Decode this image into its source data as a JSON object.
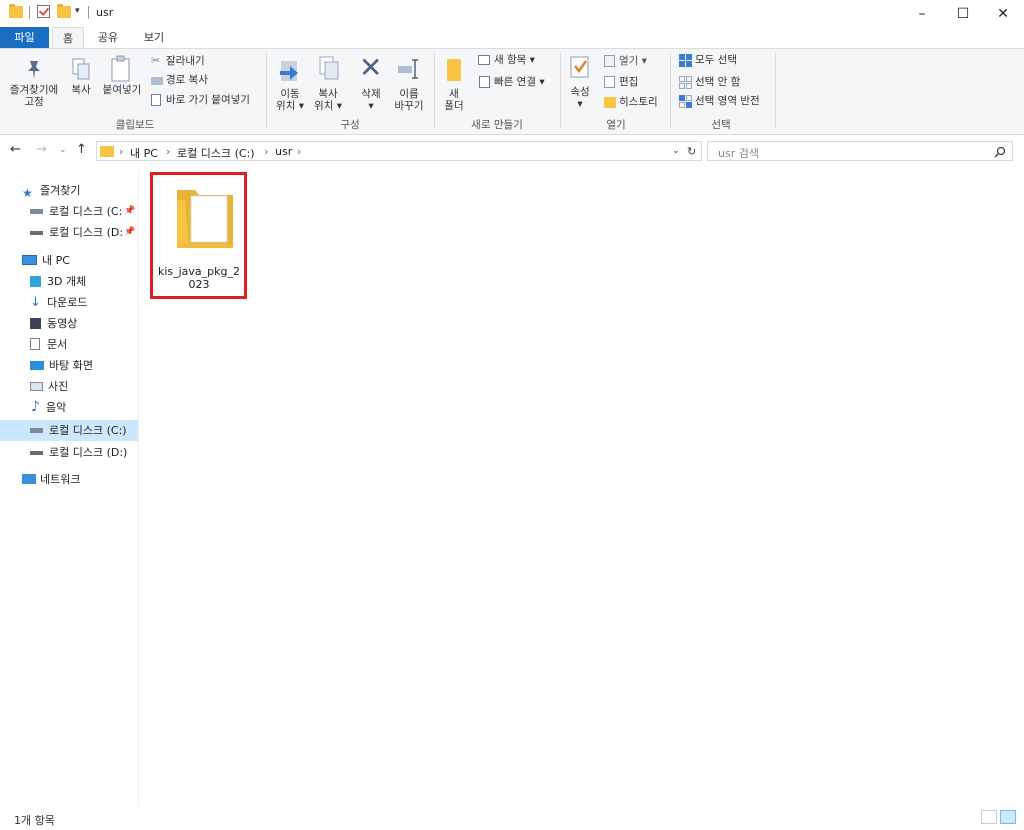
{
  "window": {
    "title": "usr"
  },
  "ribbon_tabs": [
    "파일",
    "홈",
    "공유",
    "보기"
  ],
  "ribbon": {
    "clipboard": {
      "pin_label_1": "즐겨찾기에",
      "pin_label_2": "고정",
      "copy_label": "복사",
      "paste_label": "붙여넣기",
      "cut_label": "잘라내기",
      "copy_path_label": "경로 복사",
      "paste_shortcut_label": "바로 가기 붙여넣기",
      "group_label": "클립보드"
    },
    "organize": {
      "move_label_1": "이동",
      "move_label_2": "위치 ▾",
      "copyto_label_1": "복사",
      "copyto_label_2": "위치 ▾",
      "delete_label": "삭제",
      "delete_arrow": "▾",
      "rename_label_1": "이름",
      "rename_label_2": "바꾸기",
      "group_label": "구성"
    },
    "new": {
      "new_folder_label_1": "새",
      "new_folder_label_2": "폴더",
      "new_item_label": "새 항목 ▾",
      "easy_access_label": "빠른 연결 ▾",
      "group_label": "새로 만들기"
    },
    "open": {
      "properties_label": "속성",
      "properties_arrow": "▾",
      "open_label": "열기 ▾",
      "edit_label": "편집",
      "history_label": "히스토리",
      "group_label": "열기"
    },
    "select": {
      "select_all_label": "모두 선택",
      "select_none_label": "선택 안 함",
      "invert_label": "선택 영역 반전",
      "group_label": "선택"
    }
  },
  "address": {
    "crumbs": [
      "내 PC",
      "로컬 디스크 (C:)",
      "usr"
    ],
    "search_placeholder": "usr 검색"
  },
  "nav": {
    "quick_access": "즐겨찾기",
    "qa_items": [
      "로컬 디스크 (C:",
      "로컬 디스크 (D:"
    ],
    "this_pc": "내 PC",
    "pc_items": [
      "3D 개체",
      "다운로드",
      "동영상",
      "문서",
      "바탕 화면",
      "사진",
      "음악",
      "로컬 디스크 (C:)",
      "로컬 디스크 (D:)"
    ],
    "network": "네트워크"
  },
  "content": {
    "items": [
      {
        "name": "kis_java_pkg_2023"
      }
    ]
  },
  "status": {
    "item_count": "1개 항목"
  },
  "colors": {
    "accent": "#1a6ec1",
    "highlight_box": "#e02020",
    "selection": "#cce8ff",
    "folder": "#f6c343"
  }
}
